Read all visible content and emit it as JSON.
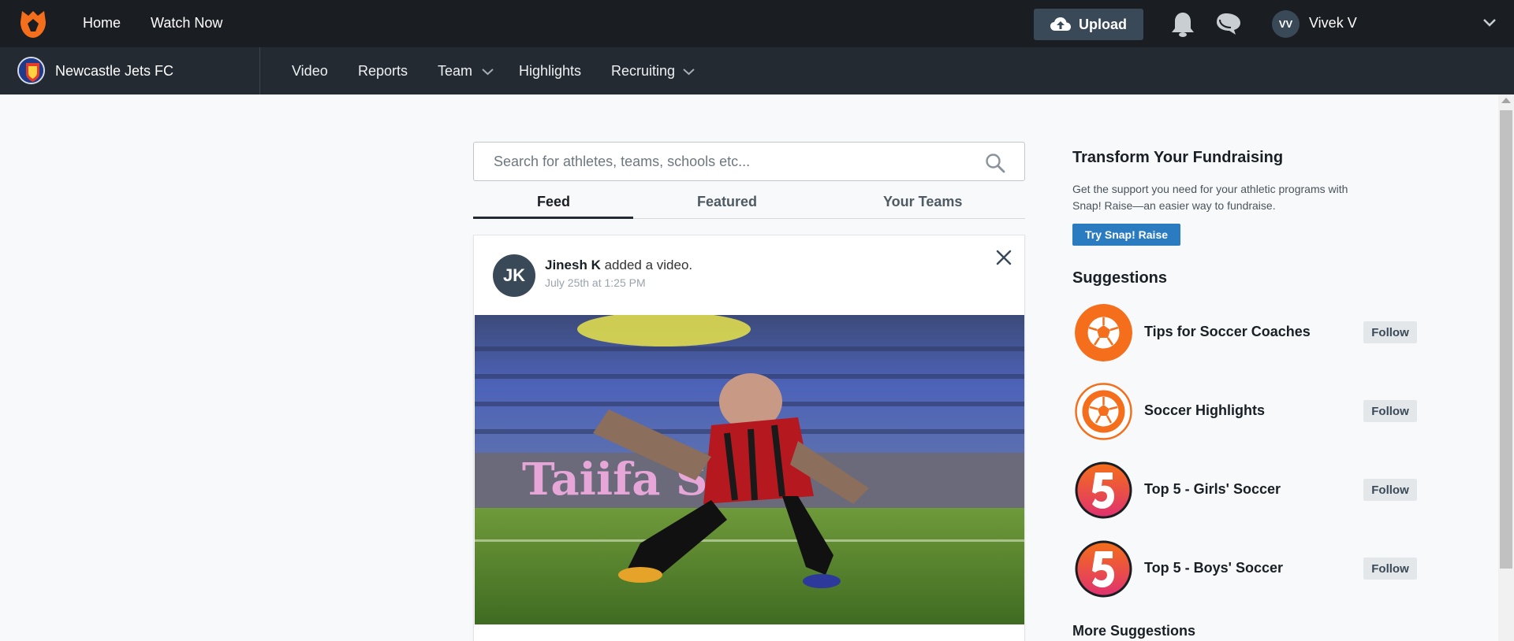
{
  "topbar": {
    "logo_icon": "hudl-logo-icon",
    "nav": [
      "Home",
      "Watch Now"
    ],
    "upload_label": "Upload",
    "user_initials": "VV",
    "user_name": "Vivek V"
  },
  "subbar": {
    "team_name": "Newcastle Jets FC",
    "nav": [
      {
        "label": "Video",
        "has_dropdown": false
      },
      {
        "label": "Reports",
        "has_dropdown": false
      },
      {
        "label": "Team",
        "has_dropdown": true
      },
      {
        "label": "Highlights",
        "has_dropdown": false
      },
      {
        "label": "Recruiting",
        "has_dropdown": true
      }
    ]
  },
  "search": {
    "placeholder": "Search for athletes, teams, schools etc..."
  },
  "tabs": [
    {
      "label": "Feed",
      "active": true
    },
    {
      "label": "Featured",
      "active": false
    },
    {
      "label": "Your Teams",
      "active": false
    }
  ],
  "post": {
    "avatar_initials": "JK",
    "author": "Jinesh K",
    "action": "added a video.",
    "timestamp": "July 25th at 1:25 PM",
    "video_overlay_text": "Taiifa SA"
  },
  "sidebar": {
    "promo_title": "Transform Your Fundraising",
    "promo_text": "Get the support you need for your athletic programs with Snap! Raise—an easier way to fundraise.",
    "promo_button": "Try Snap! Raise",
    "suggestions_title": "Suggestions",
    "suggestions": [
      {
        "name": "Tips for Soccer Coaches",
        "follow": "Follow",
        "icon": "soccer-ball-icon"
      },
      {
        "name": "Soccer Highlights",
        "follow": "Follow",
        "icon": "soccer-ball-outline-icon"
      },
      {
        "name": "Top 5 - Girls' Soccer",
        "follow": "Follow",
        "icon": "top5-badge-icon"
      },
      {
        "name": "Top 5 - Boys' Soccer",
        "follow": "Follow",
        "icon": "top5-badge-icon"
      }
    ],
    "more_suggestions": "More Suggestions"
  },
  "colors": {
    "topbar_bg": "#1a1e23",
    "subbar_bg": "#232a31",
    "brand_orange": "#f46e1b",
    "snap_blue": "#2b7bc1"
  }
}
